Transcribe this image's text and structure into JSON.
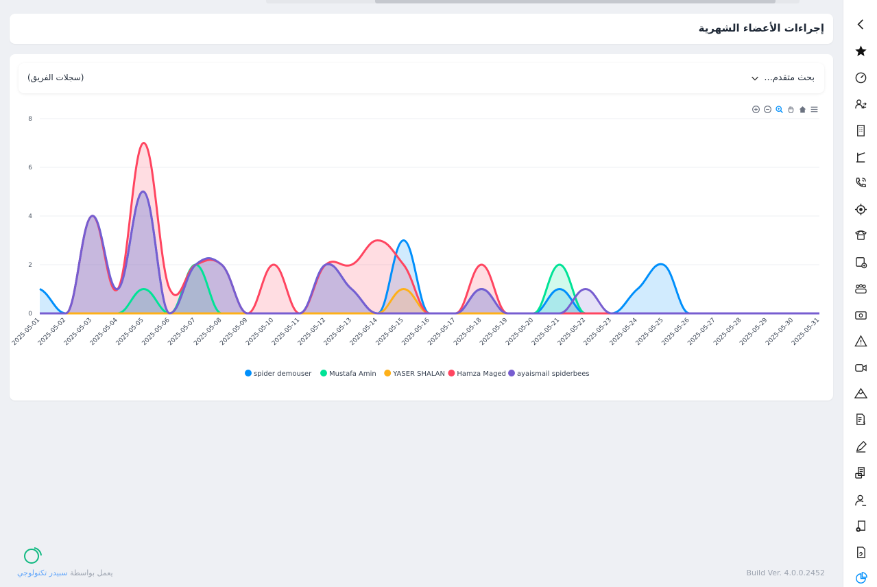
{
  "page": {
    "title": "إجراءات الأعضاء الشهرية",
    "advanced_search": "بحث متقدم...",
    "team_log": "(سجلات الفريق)"
  },
  "footer": {
    "build": "Build Ver. 4.0.0.2452",
    "powered_prefix": "يعمل بواسطة",
    "powered_brand": "سبيدر تكنولوجي"
  },
  "toolbar_icons": [
    "zoom-in-icon",
    "zoom-out-icon",
    "zoom-select-icon",
    "pan-hand-icon",
    "home-icon",
    "menu-icon"
  ],
  "sidebar_icons": [
    "chevron-left-icon",
    "star-icon",
    "speedometer-icon",
    "users-transfer-icon",
    "building-icon",
    "barrier-icon",
    "phone-call-icon",
    "target-icon",
    "telephone-icon",
    "calendar-add-icon",
    "team-icon",
    "money-icon",
    "warning-icon",
    "video-camera-icon",
    "mountain-icon",
    "invoice-dollar-icon",
    "pen-icon",
    "document-list-icon",
    "user-edit-icon",
    "document-add-icon",
    "document-hand-icon",
    "pie-chart-icon"
  ],
  "chart_data": {
    "type": "area",
    "curve": "smooth",
    "x": [
      "2025-05-01",
      "2025-05-02",
      "2025-05-03",
      "2025-05-04",
      "2025-05-05",
      "2025-05-06",
      "2025-05-07",
      "2025-05-08",
      "2025-05-09",
      "2025-05-10",
      "2025-05-11",
      "2025-05-12",
      "2025-05-13",
      "2025-05-14",
      "2025-05-15",
      "2025-05-16",
      "2025-05-17",
      "2025-05-18",
      "2025-05-19",
      "2025-05-20",
      "2025-05-21",
      "2025-05-22",
      "2025-05-23",
      "2025-05-24",
      "2025-05-25",
      "2025-05-26",
      "2025-05-27",
      "2025-05-28",
      "2025-05-29",
      "2025-05-30",
      "2025-05-31"
    ],
    "yticks": [
      0,
      2,
      4,
      6,
      8
    ],
    "ylim": [
      0,
      8
    ],
    "grid": true,
    "legend": "bottom-center",
    "series": [
      {
        "name": "spider demouser",
        "color": "#008ffb",
        "values": [
          1,
          0,
          4,
          1,
          5,
          0,
          2,
          2,
          0,
          0,
          0,
          2,
          1,
          0,
          3,
          0,
          0,
          1,
          0,
          0,
          1,
          0,
          0,
          1,
          2,
          0,
          0,
          0,
          0,
          0,
          0
        ]
      },
      {
        "name": "Mustafa Amin",
        "color": "#00e396",
        "values": [
          0,
          0,
          0,
          0,
          1,
          0,
          2,
          0,
          0,
          0,
          0,
          0,
          0,
          0,
          0,
          0,
          0,
          0,
          0,
          0,
          2,
          0,
          0,
          0,
          0,
          0,
          0,
          0,
          0,
          0,
          0
        ]
      },
      {
        "name": "YASER SHALAN",
        "color": "#feb019",
        "values": [
          0,
          0,
          0,
          0,
          0,
          0,
          0,
          0,
          0,
          0,
          0,
          0,
          0,
          0,
          1,
          0,
          0,
          0,
          0,
          0,
          0,
          0,
          0,
          0,
          0,
          0,
          0,
          0,
          0,
          0,
          0
        ]
      },
      {
        "name": "Hamza Maged",
        "color": "#ff4560",
        "values": [
          0,
          0,
          4,
          1,
          7,
          1,
          2,
          2,
          0,
          2,
          0,
          2,
          2,
          3,
          2,
          0,
          0,
          2,
          0,
          0,
          0,
          0,
          0,
          0,
          0,
          0,
          0,
          0,
          0,
          0,
          0
        ]
      },
      {
        "name": "ayaismail spiderbees",
        "color": "#775dd0",
        "values": [
          0,
          0,
          4,
          1,
          5,
          0,
          2,
          2,
          0,
          0,
          0,
          2,
          1,
          0,
          0,
          0,
          0,
          1,
          0,
          0,
          0,
          1,
          0,
          0,
          0,
          0,
          0,
          0,
          0,
          0,
          0
        ]
      }
    ]
  }
}
